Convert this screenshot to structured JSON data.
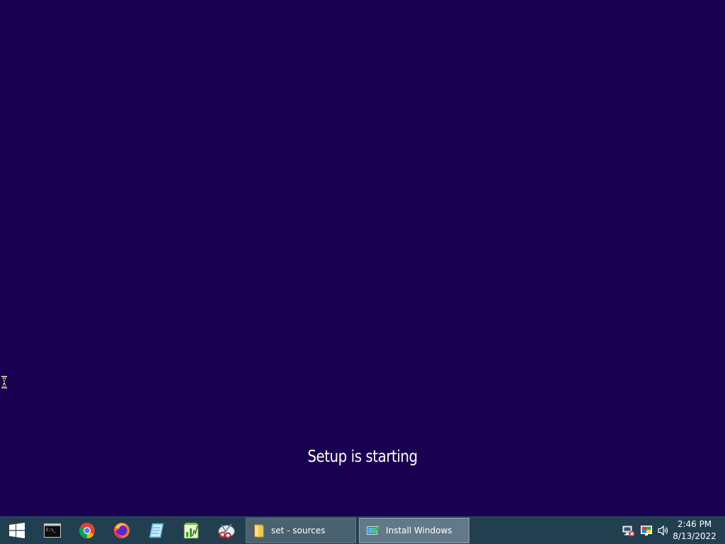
{
  "setup": {
    "status_text": "Setup is starting"
  },
  "taskbar": {
    "start_icon": "windows-logo-icon",
    "pinned": [
      {
        "icon": "command-prompt-icon"
      },
      {
        "icon": "chrome-icon"
      },
      {
        "icon": "firefox-icon"
      },
      {
        "icon": "notepad-icon"
      },
      {
        "icon": "task-manager-icon"
      },
      {
        "icon": "snipping-tool-icon"
      }
    ],
    "tasks": [
      {
        "label": "set - sources",
        "icon": "folder-icon",
        "active": false
      },
      {
        "label": "Install Windows",
        "icon": "install-windows-icon",
        "active": true
      }
    ]
  },
  "tray": {
    "icons": [
      "network-disconnected-icon",
      "display-color-icon",
      "volume-icon"
    ],
    "time": "2:46 PM",
    "date": "8/13/2022"
  },
  "colors": {
    "desktop_background": "#1a0050",
    "taskbar_background": "#223f50",
    "active_task": "#62798a",
    "inactive_task": "#4a6270"
  }
}
